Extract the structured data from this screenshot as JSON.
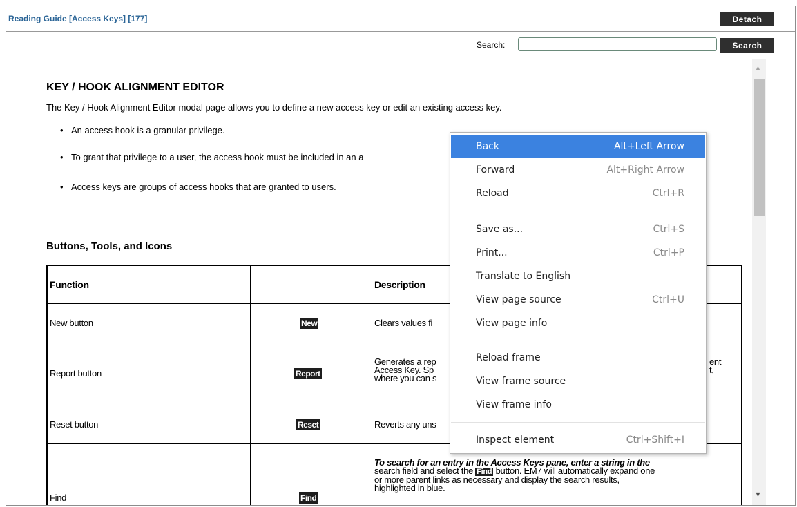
{
  "window": {
    "title": "Reading Guide [Access Keys] [177]",
    "detach_label": "Detach",
    "search_label": "Search:",
    "search_value": "",
    "search_button": "Search"
  },
  "doc": {
    "heading": "KEY / HOOK ALIGNMENT EDITOR",
    "intro": "The Key / Hook Alignment Editor modal page allows you to define a new access key or edit an existing access key.",
    "bullets": [
      "An access hook is a granular privilege.",
      "To grant that privilege to a user, the access hook must be included in an a",
      "Access keys are groups of access hooks that are granted to users."
    ],
    "subheading": "Buttons, Tools, and Icons",
    "table": {
      "headers": [
        "Function",
        "",
        "Description"
      ],
      "rows": [
        {
          "function": "New button",
          "tag": "New",
          "description": "Clears values fi"
        },
        {
          "function": "Report button",
          "tag": "Report",
          "description_lines": [
            "Generates a rep",
            "Access Key. Sp",
            "where you can s"
          ],
          "description_right": [
            "ent",
            "t,"
          ]
        },
        {
          "function": "Reset button",
          "tag": "Reset",
          "description": "Reverts any uns"
        },
        {
          "function": "Find",
          "tag": "Find",
          "description_lines": [
            "To search for an entry in the Access Keys pane, enter a string in the",
            "search field and select the",
            "button. EM7 will automatically expand one",
            "or more parent links as necessary and display the search results,",
            "highlighted in blue."
          ],
          "inline_tag": "Find"
        }
      ]
    }
  },
  "context_menu": {
    "items": [
      {
        "label": "Back",
        "shortcut": "Alt+Left Arrow",
        "highlighted": true
      },
      {
        "label": "Forward",
        "shortcut": "Alt+Right Arrow"
      },
      {
        "label": "Reload",
        "shortcut": "Ctrl+R"
      },
      {
        "label": "Save as...",
        "shortcut": "Ctrl+S"
      },
      {
        "label": "Print...",
        "shortcut": "Ctrl+P"
      },
      {
        "label": "Translate to English",
        "shortcut": ""
      },
      {
        "label": "View page source",
        "shortcut": "Ctrl+U"
      },
      {
        "label": "View page info",
        "shortcut": ""
      },
      {
        "label": "Reload frame",
        "shortcut": ""
      },
      {
        "label": "View frame source",
        "shortcut": ""
      },
      {
        "label": "View frame info",
        "shortcut": ""
      },
      {
        "label": "Inspect element",
        "shortcut": "Ctrl+Shift+I"
      }
    ],
    "highlight_color": "#3b82e0"
  }
}
